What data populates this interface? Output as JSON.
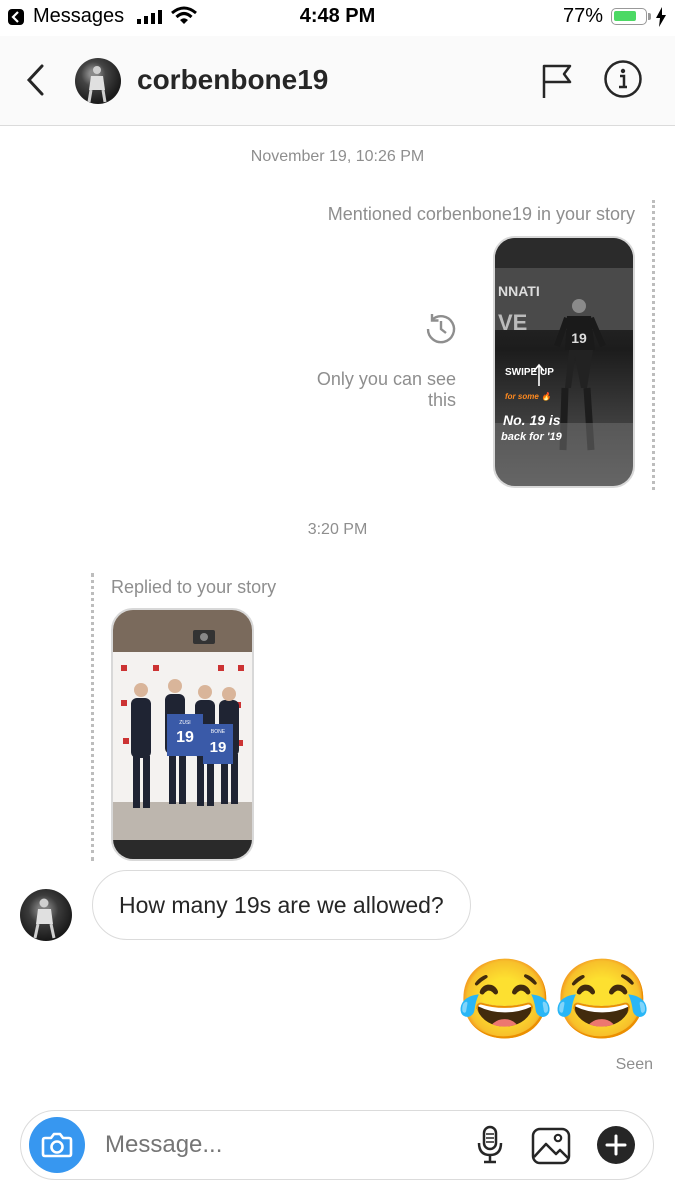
{
  "status_bar": {
    "app": "Messages",
    "time": "4:48 PM",
    "battery_pct": "77%",
    "battery_level": 0.77,
    "icons": [
      "back-app-icon",
      "signal-icon",
      "wifi-icon",
      "battery-icon",
      "charging-icon"
    ]
  },
  "header": {
    "username": "corbenbone19",
    "icons": [
      "back-chevron-icon",
      "flag-icon",
      "info-icon"
    ]
  },
  "thread": {
    "timestamp_1": "November 19, 10:26 PM",
    "mention_label": "Mentioned corbenbone19 in your story",
    "only_you": "Only you can see this",
    "story_swipe": "SWIPE UP",
    "story_for_some": "for some 🔥",
    "story_line1": "No. 19 is",
    "story_line2": "back for '19",
    "timestamp_2": "3:20 PM",
    "replied_label": "Replied to your story",
    "message_received": "How many 19s are we allowed?",
    "message_sent": "😂😂",
    "seen": "Seen"
  },
  "composer": {
    "placeholder": "Message...",
    "icons": [
      "camera-icon",
      "microphone-icon",
      "gallery-icon",
      "plus-icon"
    ]
  },
  "colors": {
    "accent_blue": "#3797f0",
    "battery_green": "#4cd964",
    "text_primary": "#262626",
    "text_secondary": "#8e8e8e"
  }
}
